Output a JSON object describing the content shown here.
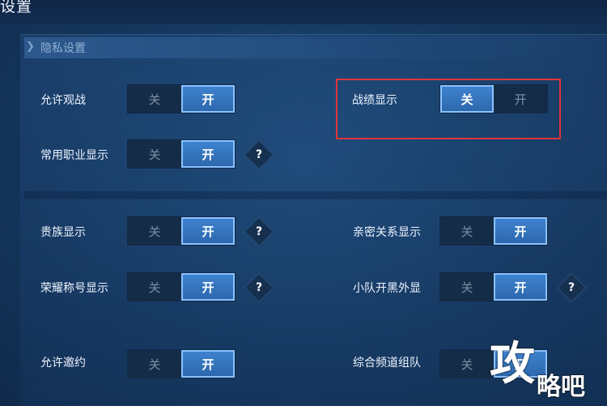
{
  "header": {
    "title": "设置"
  },
  "section": {
    "title": "隐私设置"
  },
  "toggle_labels": {
    "off": "关",
    "on": "开"
  },
  "help_glyph": "?",
  "rows": {
    "allow_spectate": {
      "label": "允许观战",
      "state": "on"
    },
    "battle_record": {
      "label": "战绩显示",
      "state": "off"
    },
    "common_role": {
      "label": "常用职业显示",
      "state": "on"
    },
    "noble": {
      "label": "贵族显示",
      "state": "on"
    },
    "intimate": {
      "label": "亲密关系显示",
      "state": "on"
    },
    "honor_title": {
      "label": "荣耀称号显示",
      "state": "on"
    },
    "team_blackout": {
      "label": "小队开黑外显",
      "state": "on"
    },
    "partial_left": {
      "label": "允许邀约",
      "state": "on"
    },
    "partial_right": {
      "label": "综合频道组队",
      "state": "on"
    }
  },
  "watermark": {
    "big": "攻",
    "small": "略吧"
  },
  "colors": {
    "highlight": "#e0353a",
    "active": "#3f84d0",
    "background": "#163a62"
  }
}
